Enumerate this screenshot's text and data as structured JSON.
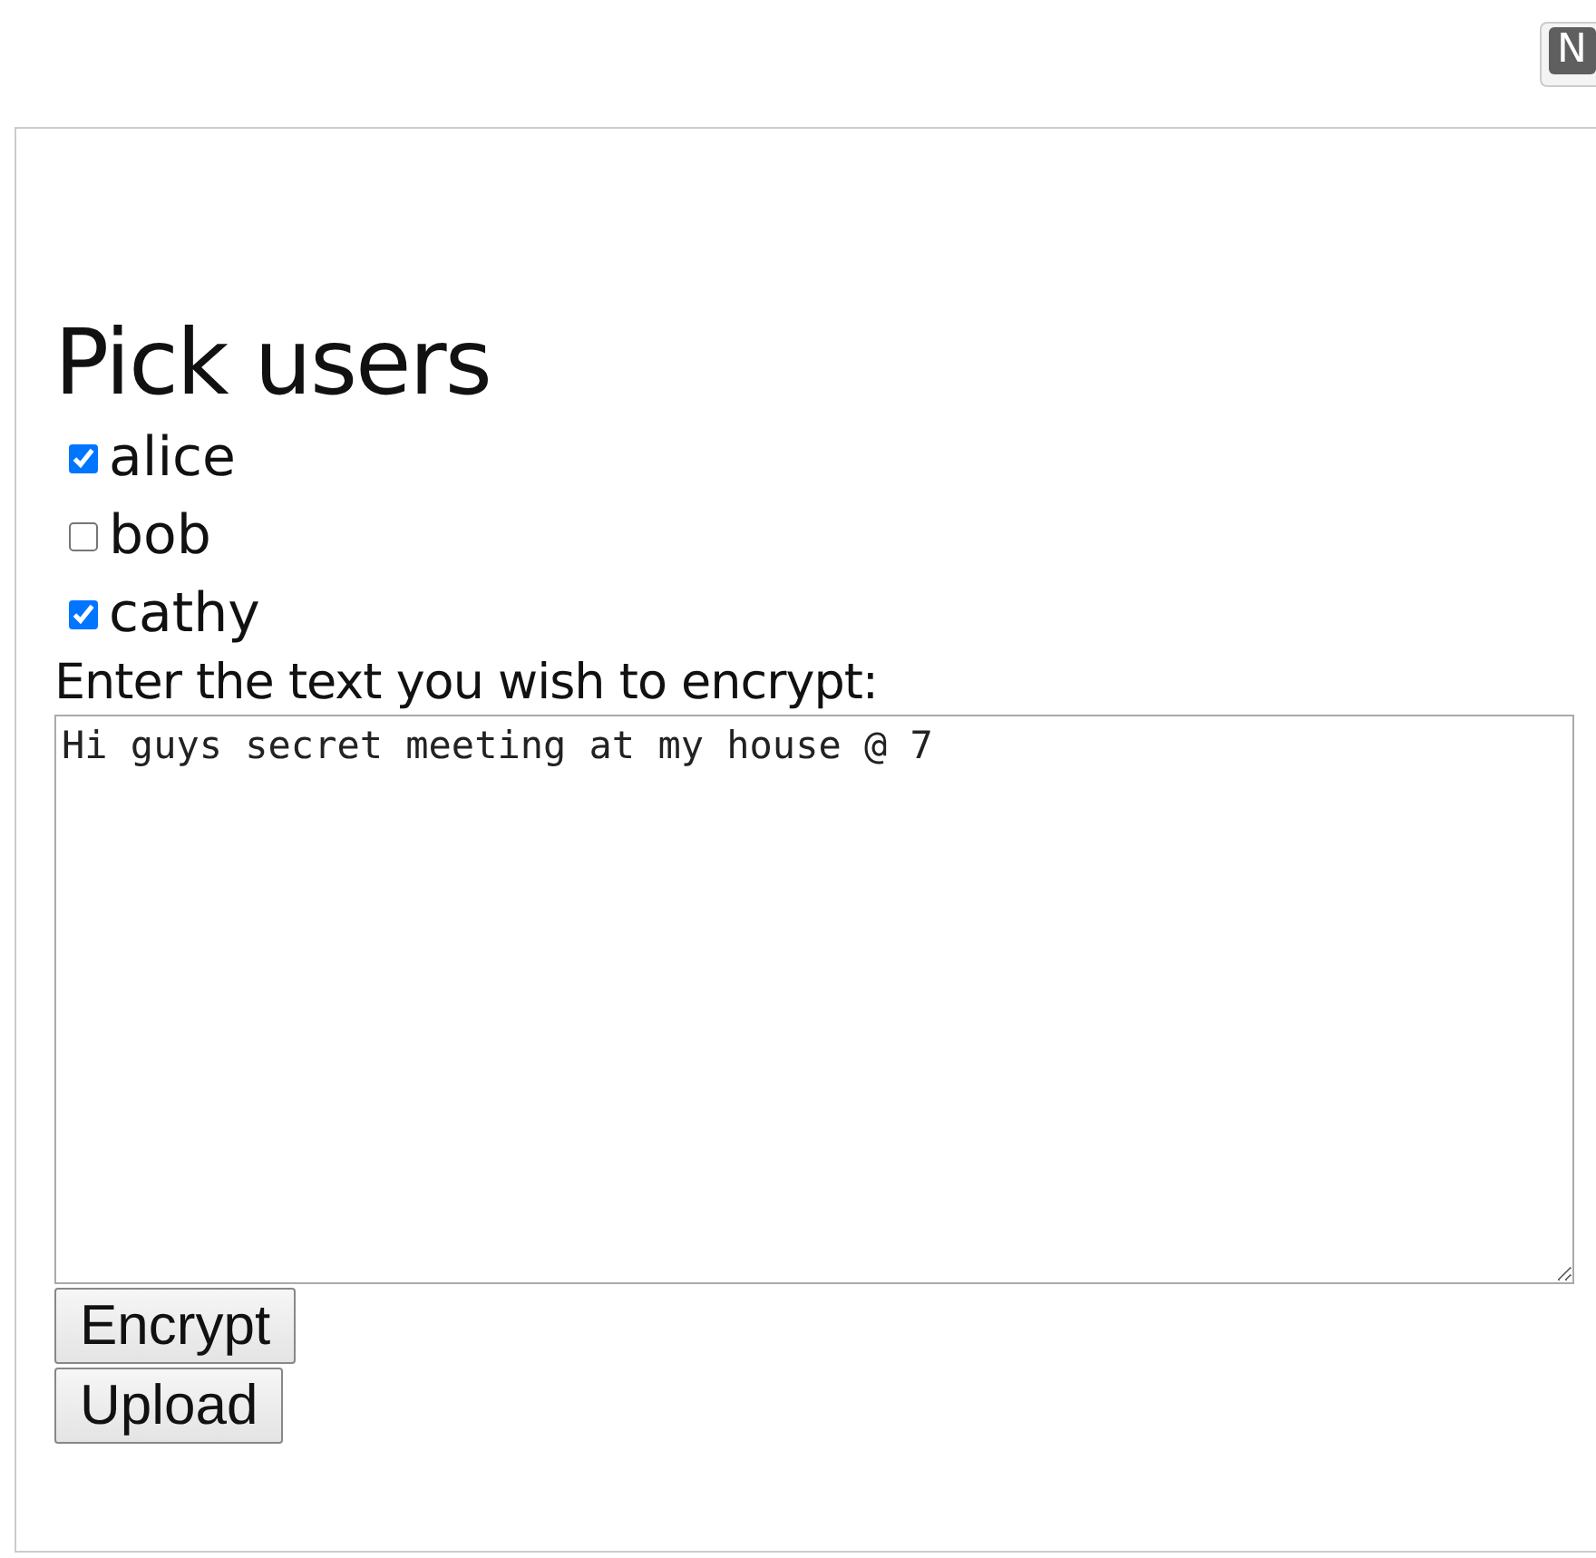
{
  "extension_badge": "N",
  "heading": "Pick users",
  "users": [
    {
      "label": "alice",
      "checked": true
    },
    {
      "label": "bob",
      "checked": false
    },
    {
      "label": "cathy",
      "checked": true
    }
  ],
  "message": {
    "label": "Enter the text you wish to encrypt:",
    "value": "Hi guys secret meeting at my house @ 7"
  },
  "buttons": [
    "Encrypt",
    "Upload"
  ]
}
